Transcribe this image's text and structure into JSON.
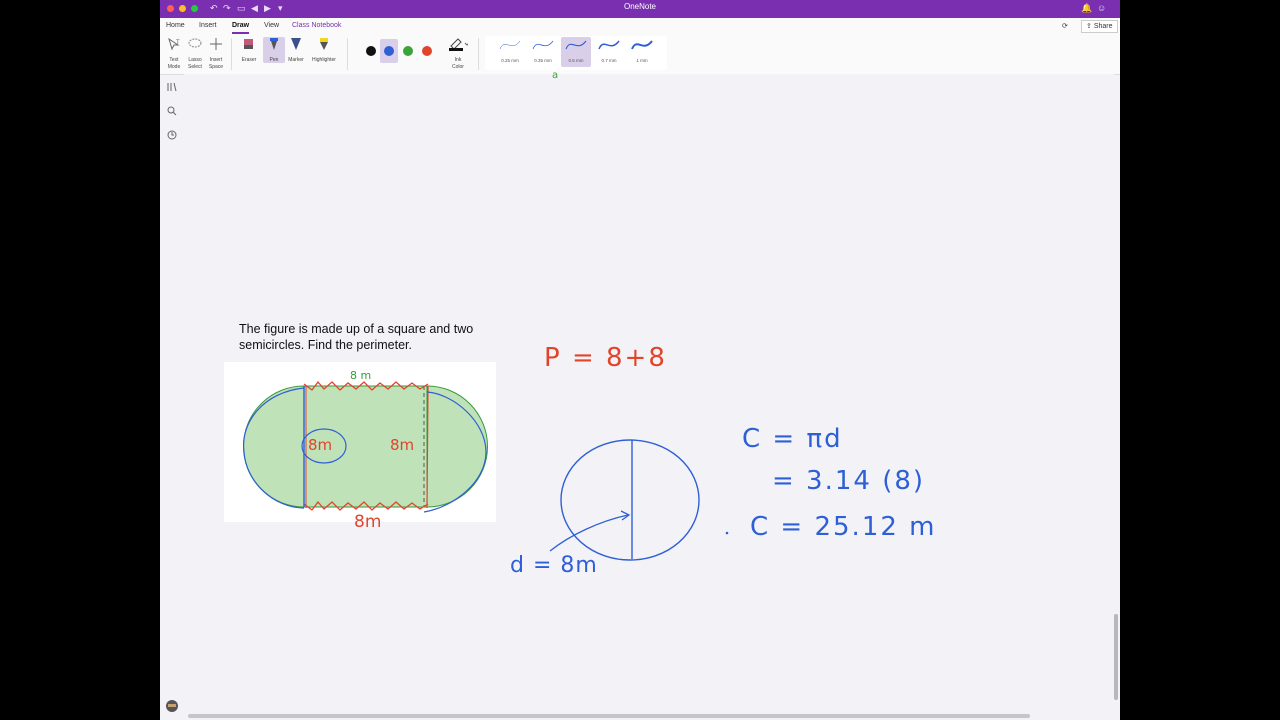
{
  "window": {
    "title": "OneNote"
  },
  "titlebar": {
    "share_label": "Share"
  },
  "menu": {
    "items": [
      "Home",
      "Insert",
      "Draw",
      "View",
      "Class Notebook"
    ],
    "active": "Draw"
  },
  "ribbon": {
    "tools": [
      {
        "line1": "Text",
        "line2": "Mode"
      },
      {
        "line1": "Lasso",
        "line2": "Select"
      },
      {
        "line1": "Insert",
        "line2": "Space"
      },
      {
        "line1": "Eraser",
        "line2": ""
      },
      {
        "line1": "Pen",
        "line2": ""
      },
      {
        "line1": "Marker",
        "line2": ""
      },
      {
        "line1": "Highlighter",
        "line2": ""
      }
    ],
    "colors": [
      "#111111",
      "#2f5fd6",
      "#3aa33a",
      "#e0452c"
    ],
    "selected_color": "#2f5fd6",
    "ink_color": {
      "line1": "Ink",
      "line2": "Color"
    },
    "thicknesses": [
      "0.25 mm",
      "0.35 mm",
      "0.5 mm",
      "0.7 mm",
      "1 mm"
    ],
    "selected_thickness": "0.5 mm"
  },
  "question": {
    "line1": "The figure is made up of a square and two",
    "line2": "semicircles.  Find the perimeter."
  },
  "handwriting": {
    "top_side": "8 m",
    "left_label": "8m",
    "right_label": "8m",
    "bottom_label": "8m",
    "perimeter_eq": "P = 8+8",
    "circ_formula": "C = πd",
    "circ_sub": "= 3.14 (8)",
    "circ_result": "C = 25.12 m",
    "diameter": "d = 8m",
    "stray_mark": "a"
  }
}
